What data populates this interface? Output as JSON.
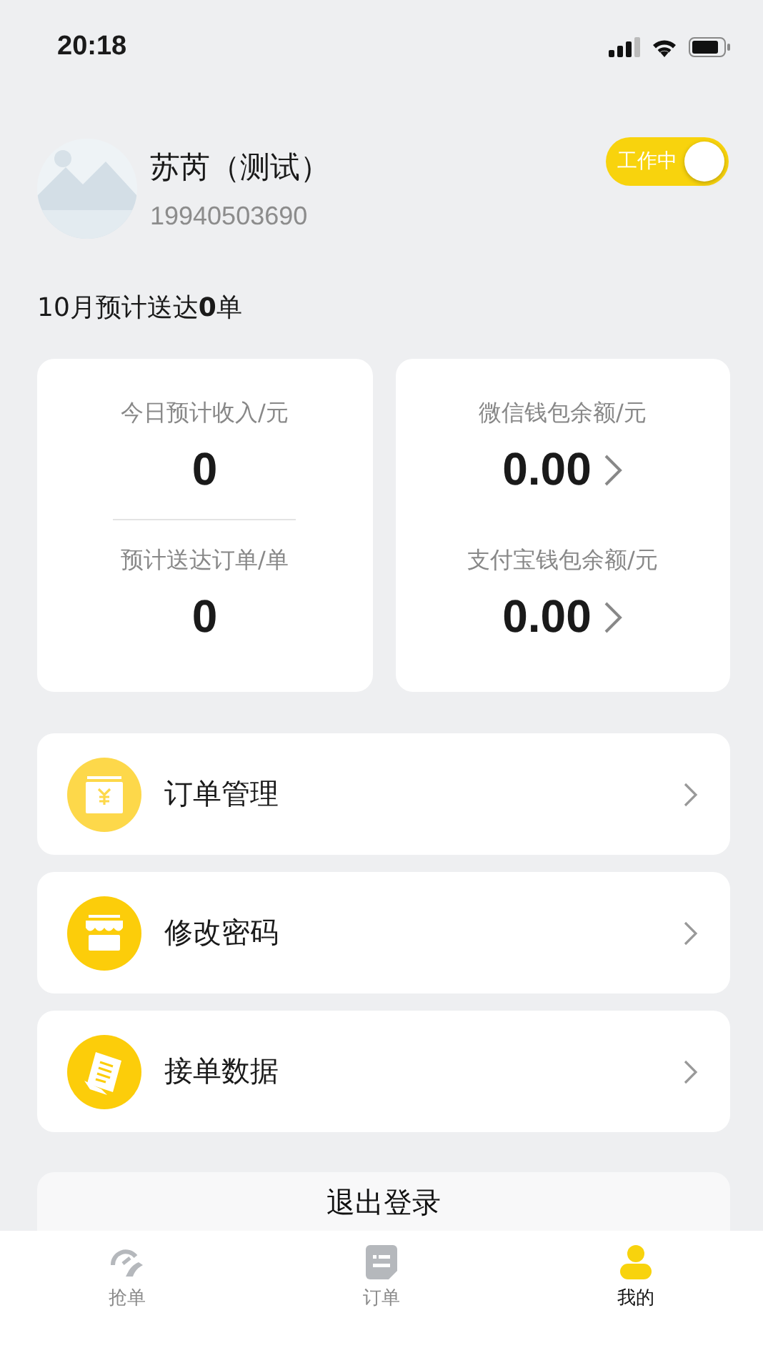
{
  "status_bar": {
    "time": "20:18"
  },
  "profile": {
    "name": "苏芮（测试）",
    "phone": "19940503690",
    "work_toggle": {
      "label": "工作中",
      "on": true
    }
  },
  "monthly_summary": "10月预计送达**0**单",
  "stat_cards": [
    {
      "divider": true,
      "items": [
        {
          "label": "今日预计收入/元",
          "value": "0",
          "link": false
        },
        {
          "label": "预计送达订单/单",
          "value": "0",
          "link": false
        }
      ]
    },
    {
      "divider": false,
      "items": [
        {
          "label": "微信钱包余额/元",
          "value": "0.00",
          "link": true
        },
        {
          "label": "支付宝钱包余额/元",
          "value": "0.00",
          "link": true
        }
      ]
    }
  ],
  "menu": [
    {
      "label": "订单管理",
      "kind": "cashbox"
    },
    {
      "label": "修改密码",
      "kind": "shop"
    },
    {
      "label": "接单数据",
      "kind": "document"
    }
  ],
  "logout_button": "退出登录",
  "tab_bar": [
    {
      "label": "抢单",
      "kind": "grab",
      "selected": false
    },
    {
      "label": "订单",
      "kind": "orders",
      "selected": false
    },
    {
      "label": "我的",
      "kind": "profile",
      "selected": true
    }
  ]
}
